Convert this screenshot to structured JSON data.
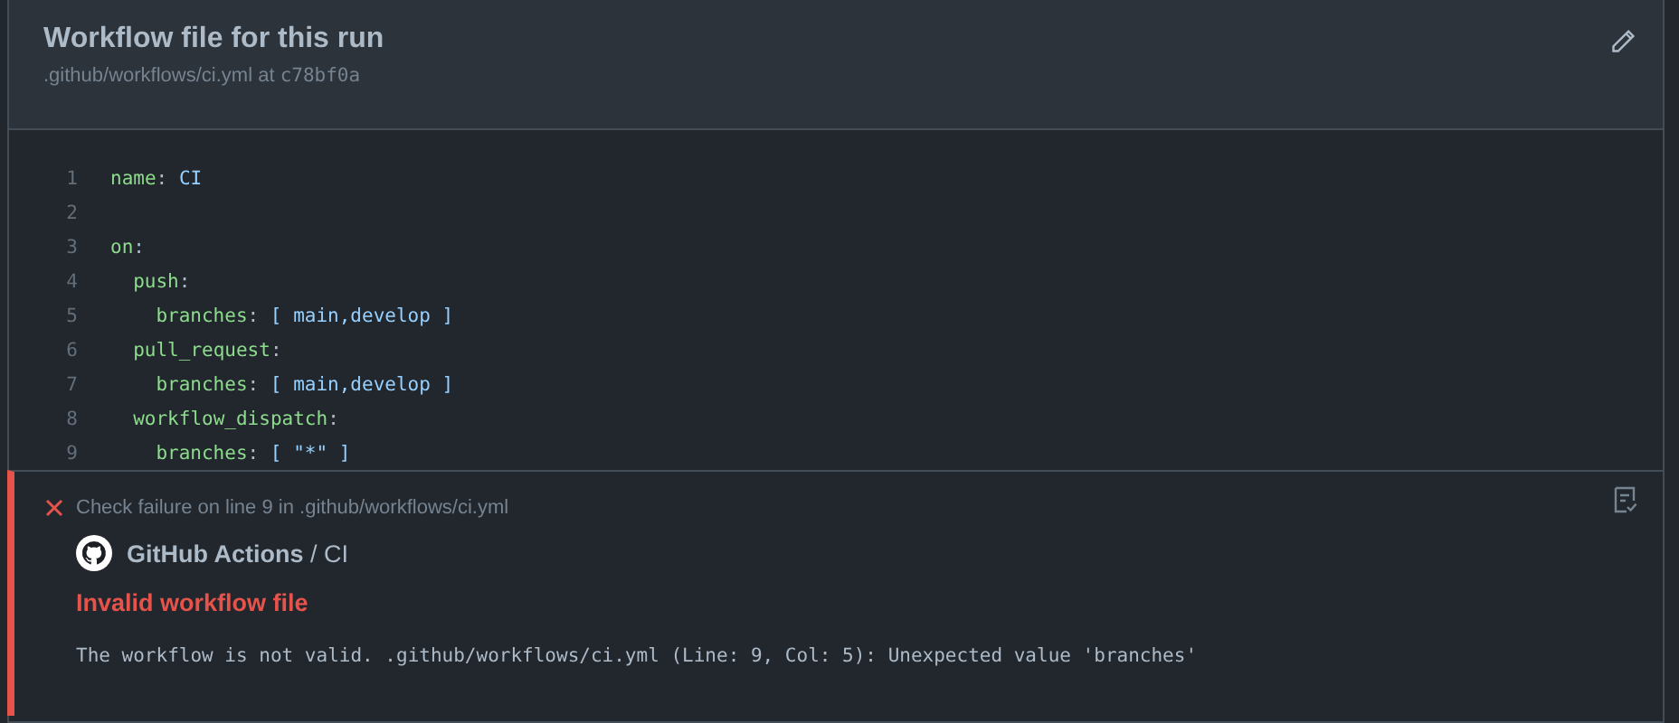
{
  "header": {
    "title": "Workflow file for this run",
    "path": ".github/workflows/ci.yml at ",
    "commit": "c78bf0a"
  },
  "code": [
    {
      "number": "1",
      "tokens": [
        {
          "kind": "key",
          "text": "name"
        },
        {
          "kind": "punct",
          "text": ": "
        },
        {
          "kind": "value",
          "text": "CI"
        }
      ]
    },
    {
      "number": "2"
    },
    {
      "number": "3",
      "tokens": [
        {
          "kind": "key",
          "text": "on"
        },
        {
          "kind": "punct",
          "text": ":"
        }
      ],
      "children": [
        {
          "number": "4",
          "tokens": [
            {
              "kind": "key",
              "text": "push"
            },
            {
              "kind": "punct",
              "text": ":"
            }
          ],
          "children": [
            {
              "number": "5",
              "tokens": [
                {
                  "kind": "key",
                  "text": "branches"
                },
                {
                  "kind": "punct",
                  "text": ": "
                },
                {
                  "kind": "value",
                  "text": "[ main,develop ]"
                }
              ]
            }
          ]
        },
        {
          "number": "6",
          "tokens": [
            {
              "kind": "key",
              "text": "pull_request"
            },
            {
              "kind": "punct",
              "text": ":"
            }
          ],
          "children": [
            {
              "number": "7",
              "tokens": [
                {
                  "kind": "key",
                  "text": "branches"
                },
                {
                  "kind": "punct",
                  "text": ": "
                },
                {
                  "kind": "value",
                  "text": "[ main,develop ]"
                }
              ]
            }
          ]
        },
        {
          "number": "8",
          "tokens": [
            {
              "kind": "key",
              "text": "workflow_dispatch"
            },
            {
              "kind": "punct",
              "text": ":"
            }
          ],
          "children": [
            {
              "number": "9",
              "tokens": [
                {
                  "kind": "key",
                  "text": "branches"
                },
                {
                  "kind": "punct",
                  "text": ": "
                },
                {
                  "kind": "value",
                  "text": "[ \"*\" ]"
                }
              ]
            }
          ]
        }
      ]
    }
  ],
  "annotation": {
    "summary": "Check failure on line 9 in .github/workflows/ci.yml",
    "app": "GitHub Actions",
    "separator": " / ",
    "check": "CI",
    "title": "Invalid workflow file",
    "message": "The workflow is not valid. .github/workflows/ci.yml (Line: 9, Col: 5): Unexpected value 'branches'"
  }
}
